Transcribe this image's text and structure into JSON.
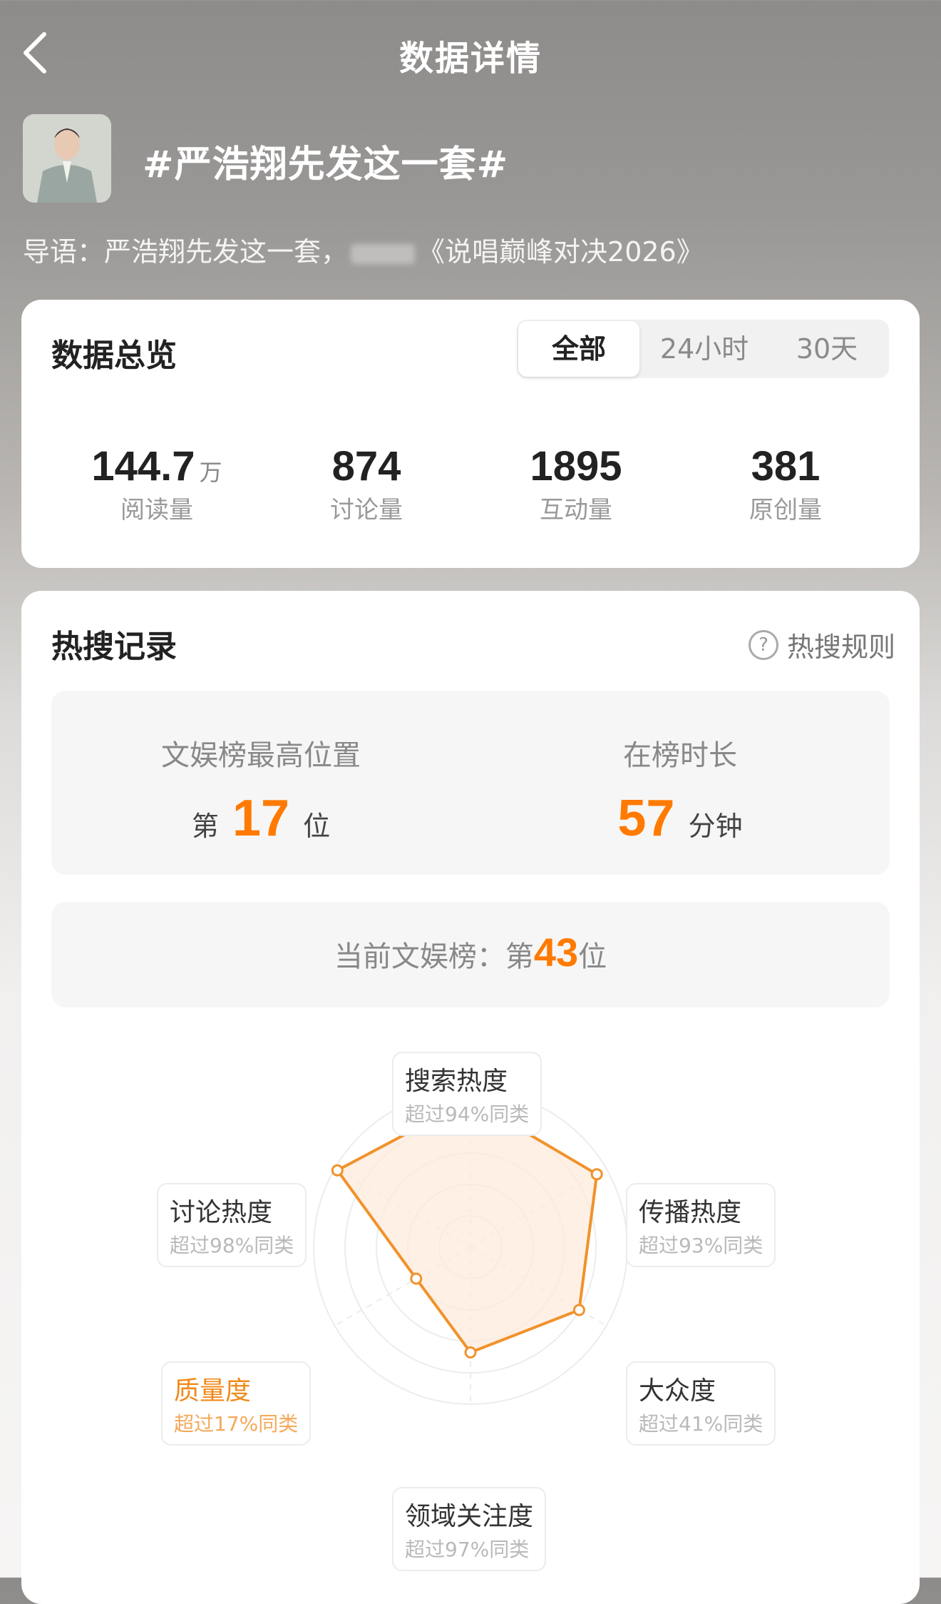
{
  "nav": {
    "title": "数据详情"
  },
  "topic": {
    "title": "#严浩翔先发这一套#",
    "intro_prefix": "导语：严浩翔先发这一套，",
    "intro_suffix": "《说唱巅峰对决2026》"
  },
  "overview": {
    "title": "数据总览",
    "tabs": [
      "全部",
      "24小时",
      "30天"
    ],
    "active_tab": "全部",
    "stats": [
      {
        "value": "144.7",
        "unit": "万",
        "label": "阅读量"
      },
      {
        "value": "874",
        "unit": "",
        "label": "讨论量"
      },
      {
        "value": "1895",
        "unit": "",
        "label": "互动量"
      },
      {
        "value": "381",
        "unit": "",
        "label": "原创量"
      }
    ]
  },
  "hotsearch": {
    "title": "热搜记录",
    "rules_label": "热搜规则",
    "rules_icon": "question-circle-icon",
    "peak_label": "文娱榜最高位置",
    "peak_prefix": "第",
    "peak_value": "17",
    "peak_suffix": "位",
    "duration_label": "在榜时长",
    "duration_value": "57",
    "duration_unit": "分钟",
    "current_label": "当前文娱榜：第",
    "current_value": "43",
    "current_suffix": "位"
  },
  "radar": {
    "levels": 5,
    "axes": [
      {
        "name": "搜索热度",
        "desc": "超过94%同类",
        "value": 0.94
      },
      {
        "name": "传播热度",
        "desc": "超过93%同类",
        "value": 0.93
      },
      {
        "name": "大众度",
        "desc": "超过41%同类",
        "value": 0.8
      },
      {
        "name": "领域关注度",
        "desc": "超过97%同类",
        "value": 0.67
      },
      {
        "name": "质量度",
        "desc": "超过17%同类",
        "value": 0.4,
        "highlight": true
      },
      {
        "name": "讨论热度",
        "desc": "超过98%同类",
        "value": 0.98
      }
    ],
    "colors": {
      "line": "#f0922b",
      "fill": "#fdebdc",
      "grid": "#ececec",
      "highlight": "#f08a1a"
    }
  }
}
